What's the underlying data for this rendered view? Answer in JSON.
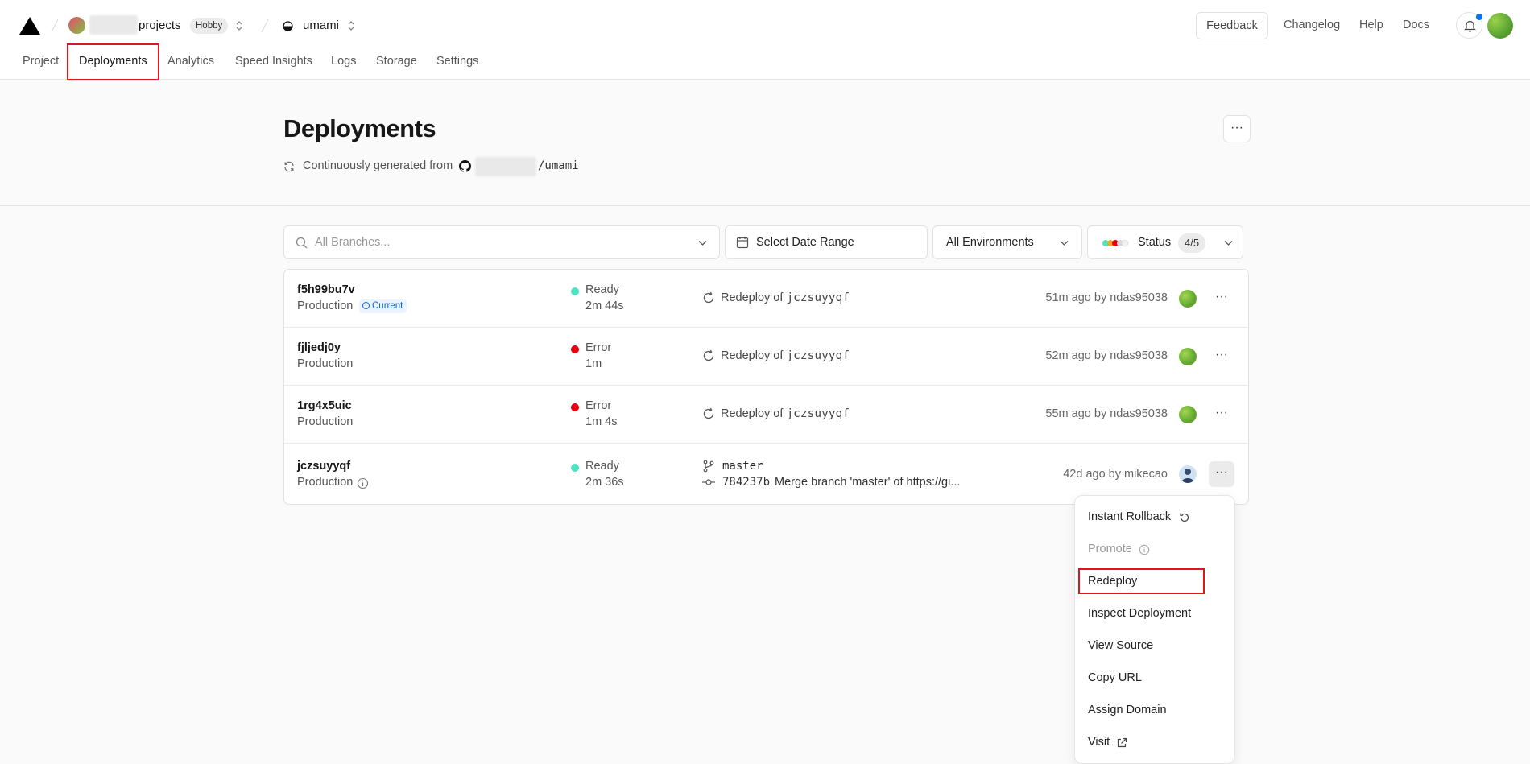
{
  "header": {
    "team_name": "projects",
    "plan_badge": "Hobby",
    "project_name": "umami",
    "feedback_label": "Feedback",
    "links": [
      "Changelog",
      "Help",
      "Docs"
    ]
  },
  "tabs": [
    "Project",
    "Deployments",
    "Analytics",
    "Speed Insights",
    "Logs",
    "Storage",
    "Settings"
  ],
  "active_tab": "Deployments",
  "page": {
    "title": "Deployments",
    "source_label": "Continuously generated from",
    "repo_suffix": "/umami",
    "more_label": "···"
  },
  "filters": {
    "branches_placeholder": "All Branches...",
    "date_range_label": "Select Date Range",
    "environments_label": "All Environments",
    "status_label": "Status",
    "status_count": "4/5"
  },
  "deployments": [
    {
      "id": "f5h99bu7v",
      "environment": "Production",
      "badge": "Current",
      "status": "Ready",
      "duration": "2m 44s",
      "source_prefix": "Redeploy of",
      "source_ref": "jczsuyyqf",
      "time_by": "51m ago by ndas95038"
    },
    {
      "id": "fjljedj0y",
      "environment": "Production",
      "status": "Error",
      "duration": "1m",
      "source_prefix": "Redeploy of",
      "source_ref": "jczsuyyqf",
      "time_by": "52m ago by ndas95038"
    },
    {
      "id": "1rg4x5uic",
      "environment": "Production",
      "status": "Error",
      "duration": "1m 4s",
      "source_prefix": "Redeploy of",
      "source_ref": "jczsuyyqf",
      "time_by": "55m ago by ndas95038"
    },
    {
      "id": "jczsuyyqf",
      "environment": "Production",
      "status": "Ready",
      "duration": "2m 36s",
      "branch": "master",
      "commit_hash": "784237b",
      "commit_message": "Merge branch 'master' of https://gi...",
      "time_by": "42d ago by mikecao"
    }
  ],
  "row_more_label": "···",
  "menu": {
    "items": [
      "Instant Rollback",
      "Promote",
      "Redeploy",
      "Inspect Deployment",
      "View Source",
      "Copy URL",
      "Assign Domain",
      "Visit"
    ]
  },
  "colors": {
    "ready": "#50e3c2",
    "error": "#e5000d",
    "highlight": "#e0161e",
    "accent": "#0a72ef"
  }
}
